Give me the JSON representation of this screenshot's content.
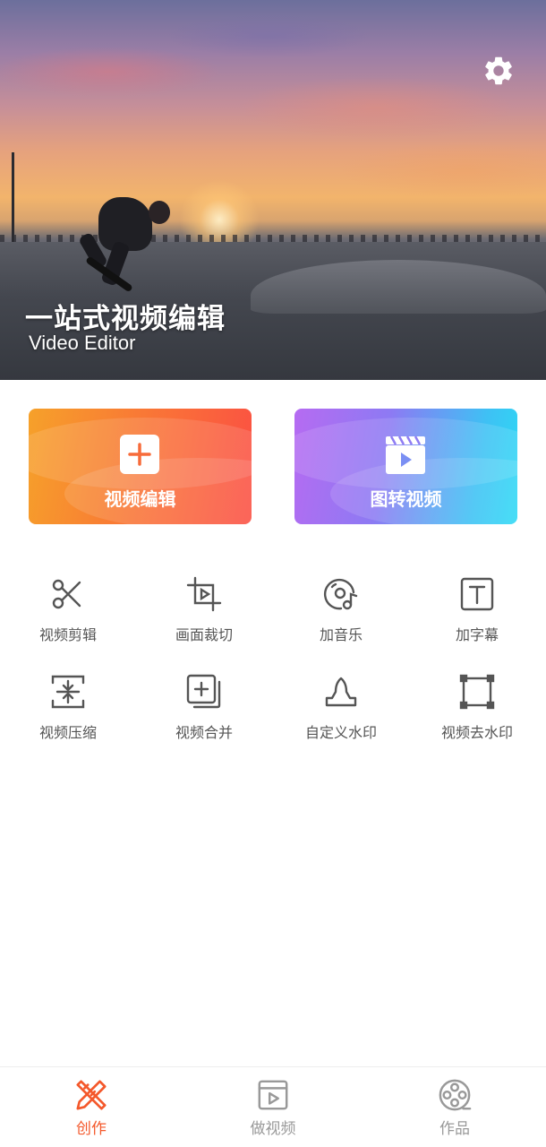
{
  "hero": {
    "title": "一站式视频编辑",
    "subtitle": "Video Editor",
    "settings_icon": "gear-icon"
  },
  "cards": [
    {
      "label": "视频编辑",
      "icon": "plus-icon",
      "colors": [
        "#f6a12a",
        "#fb4f43"
      ]
    },
    {
      "label": "图转视频",
      "icon": "clapperboard-icon",
      "colors": [
        "#b66bf2",
        "#2ddaf5"
      ]
    }
  ],
  "tools": [
    {
      "label": "视频剪辑",
      "icon": "scissors-icon"
    },
    {
      "label": "画面裁切",
      "icon": "crop-icon"
    },
    {
      "label": "加音乐",
      "icon": "music-disc-icon"
    },
    {
      "label": "加字幕",
      "icon": "text-icon"
    },
    {
      "label": "视频压缩",
      "icon": "compress-icon"
    },
    {
      "label": "视频合并",
      "icon": "merge-icon"
    },
    {
      "label": "自定义水印",
      "icon": "stamp-icon"
    },
    {
      "label": "视频去水印",
      "icon": "remove-watermark-icon"
    }
  ],
  "nav": [
    {
      "label": "创作",
      "icon": "create-icon",
      "active": true
    },
    {
      "label": "做视频",
      "icon": "video-icon",
      "active": false
    },
    {
      "label": "作品",
      "icon": "film-reel-icon",
      "active": false
    }
  ],
  "colors": {
    "accent": "#f4582b",
    "icon_gray": "#555555",
    "nav_inactive": "#999999"
  }
}
